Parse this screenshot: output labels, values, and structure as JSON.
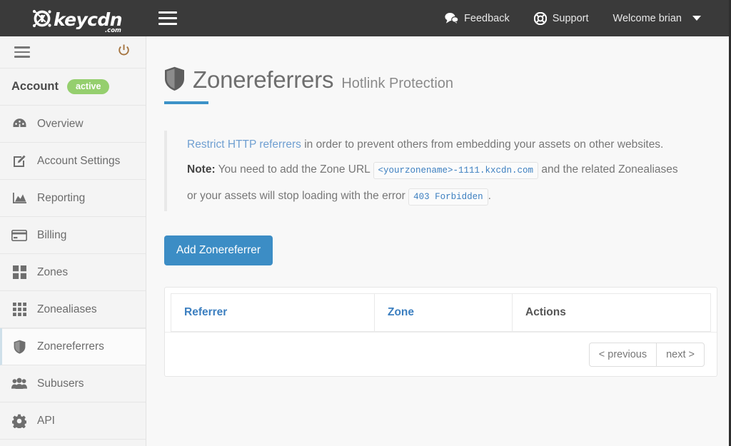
{
  "topbar": {
    "logo_text": "keycdn",
    "logo_suffix": ".com",
    "logo_icon": "keycdn-keyhole-logo",
    "menu_icon": "hamburger-menu-icon",
    "feedback_label": "Feedback",
    "feedback_icon": "speech-bubbles-icon",
    "support_label": "Support",
    "support_icon": "lifebuoy-icon",
    "user_label": "Welcome brian",
    "user_caret_icon": "chevron-down-icon"
  },
  "sidebar": {
    "collapse_icon": "hamburger-menu-icon",
    "logout_icon": "power-icon",
    "account_label": "Account",
    "account_status": "active",
    "account_status_color": "#95cf6e",
    "items": [
      {
        "label": "Overview",
        "icon": "dashboard-gauge-icon",
        "active": false
      },
      {
        "label": "Account Settings",
        "icon": "pencil-square-icon",
        "active": false
      },
      {
        "label": "Reporting",
        "icon": "area-chart-icon",
        "active": false
      },
      {
        "label": "Billing",
        "icon": "credit-card-icon",
        "active": false
      },
      {
        "label": "Zones",
        "icon": "grid-2x2-icon",
        "active": false
      },
      {
        "label": "Zonealiases",
        "icon": "grid-3x3-icon",
        "active": false
      },
      {
        "label": "Zonereferrers",
        "icon": "shield-icon",
        "active": true
      },
      {
        "label": "Subusers",
        "icon": "users-group-icon",
        "active": false
      },
      {
        "label": "API",
        "icon": "gear-icon",
        "active": false
      }
    ]
  },
  "page": {
    "title": "Zonereferrers",
    "subtitle": "Hotlink Protection",
    "title_icon": "shield-icon",
    "accent_color": "#3c92c8"
  },
  "info": {
    "link_text": "Restrict HTTP referrers",
    "line1_rest": " in order to prevent others from embedding your assets on other websites.",
    "note_label": "Note:",
    "note_part1": " You need to add the Zone URL ",
    "code1": "<yourzonename>-1111.kxcdn.com",
    "note_part2": " and the related Zonealiases or your assets will stop loading with the error ",
    "code2": "403 Forbidden",
    "note_part3": "."
  },
  "actions": {
    "add_button_label": "Add Zonereferrer",
    "add_button_color": "#3c8dc5"
  },
  "table": {
    "columns": [
      "Referrer",
      "Zone",
      "Actions"
    ],
    "rows": [],
    "pagination": {
      "previous_label": "< previous",
      "next_label": "next >"
    }
  }
}
